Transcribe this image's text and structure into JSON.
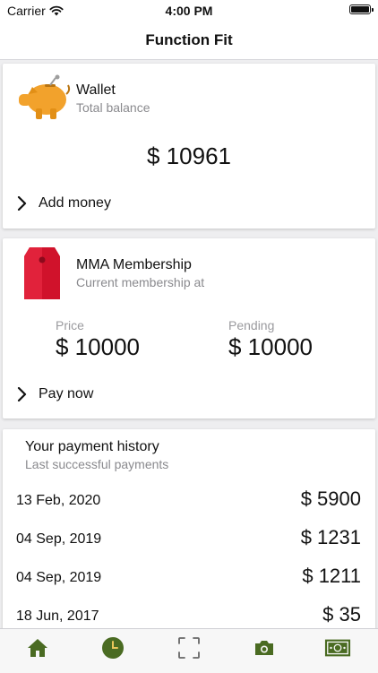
{
  "status_bar": {
    "carrier": "Carrier",
    "time": "4:00 PM"
  },
  "nav": {
    "title": "Function Fit"
  },
  "wallet": {
    "title": "Wallet",
    "subtitle": "Total balance",
    "balance": "$ 10961",
    "action_label": "Add money",
    "icon": "piggy-bank-icon",
    "icon_color": "#F2A22C"
  },
  "membership": {
    "title": "MMA Membership",
    "subtitle": "Current membership at",
    "price_label": "Price",
    "price_value": "$ 10000",
    "pending_label": "Pending",
    "pending_value": "$ 10000",
    "action_label": "Pay now",
    "icon": "price-tag-icon",
    "icon_color": "#D0122B"
  },
  "history": {
    "title": "Your payment history",
    "subtitle": "Last successful payments",
    "rows": [
      {
        "date": "13 Feb, 2020",
        "amount": "$ 5900"
      },
      {
        "date": "04 Sep, 2019",
        "amount": "$ 1231"
      },
      {
        "date": "04 Sep, 2019",
        "amount": "$ 1211"
      },
      {
        "date": "18 Jun, 2017",
        "amount": "$ 35"
      }
    ]
  },
  "tab_bar": {
    "accent_color": "#4A6B22",
    "tabs": [
      {
        "icon": "home-icon"
      },
      {
        "icon": "clock-icon"
      },
      {
        "icon": "scan-icon"
      },
      {
        "icon": "camera-icon"
      },
      {
        "icon": "cash-icon"
      }
    ]
  }
}
